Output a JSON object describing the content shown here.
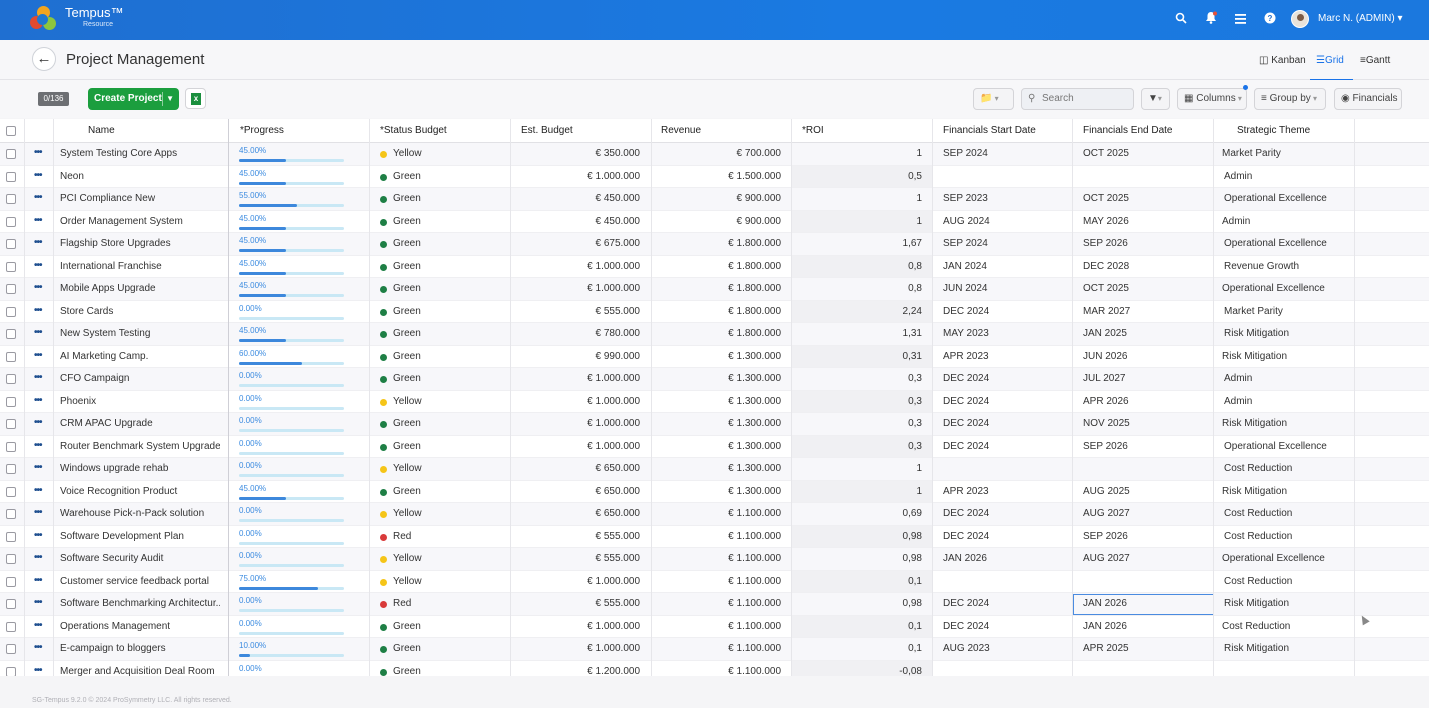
{
  "app": {
    "brand": "Tempus™",
    "brand_sub": "Resource",
    "user": "Marc N. (ADMIN) ▾",
    "icons": [
      "search-icon",
      "notification-bell-icon",
      "menu-icon",
      "help-icon"
    ]
  },
  "page": {
    "title": "Project Management",
    "views": [
      "Kanban",
      "Grid",
      "Gantt"
    ],
    "active_view": "Grid"
  },
  "toolbar": {
    "count": "0/136",
    "create_label": "Create Project",
    "search_placeholder": "Search",
    "columns_label": "Columns",
    "group_label": "Group by",
    "financials_label": "Financials"
  },
  "grid": {
    "columns": [
      "Name",
      "*Progress",
      "*Status Budget",
      "Est. Budget",
      "Revenue",
      "*ROI",
      "Financials Start Date",
      "Financials End Date",
      "Strategic Theme"
    ],
    "status_colors": {
      "Yellow": "#f5c518",
      "Green": "#1e7f45",
      "Red": "#d93a3a"
    },
    "rows": [
      {
        "name": "System Testing Core Apps",
        "progress": "45.00%",
        "progress_value": 45,
        "status": "Yellow",
        "budget": "€ 350.000",
        "revenue": "€ 700.000",
        "roi": "1",
        "start": "SEP 2024",
        "end": "OCT 2025",
        "theme": "Market Parity"
      },
      {
        "name": "Neon",
        "progress": "45.00%",
        "progress_value": 45,
        "status": "Green",
        "budget": "€ 1.000.000",
        "revenue": "€ 1.500.000",
        "roi": "0,5",
        "start": "",
        "end": "",
        "theme": "Admin"
      },
      {
        "name": "PCI Compliance New",
        "progress": "55.00%",
        "progress_value": 55,
        "status": "Green",
        "budget": "€ 450.000",
        "revenue": "€ 900.000",
        "roi": "1",
        "start": "SEP 2023",
        "end": "OCT 2025",
        "theme": "Operational Excellence"
      },
      {
        "name": "Order Management System",
        "progress": "45.00%",
        "progress_value": 45,
        "status": "Green",
        "budget": "€ 450.000",
        "revenue": "€ 900.000",
        "roi": "1",
        "start": "AUG 2024",
        "end": "MAY 2026",
        "theme": "Admin"
      },
      {
        "name": "Flagship Store Upgrades",
        "progress": "45.00%",
        "progress_value": 45,
        "status": "Green",
        "budget": "€ 675.000",
        "revenue": "€ 1.800.000",
        "roi": "1,67",
        "start": "SEP 2024",
        "end": "SEP 2026",
        "theme": "Operational Excellence"
      },
      {
        "name": "International Franchise",
        "progress": "45.00%",
        "progress_value": 45,
        "status": "Green",
        "budget": "€ 1.000.000",
        "revenue": "€ 1.800.000",
        "roi": "0,8",
        "start": "JAN 2024",
        "end": "DEC 2028",
        "theme": "Revenue Growth"
      },
      {
        "name": "Mobile Apps Upgrade",
        "progress": "45.00%",
        "progress_value": 45,
        "status": "Green",
        "budget": "€ 1.000.000",
        "revenue": "€ 1.800.000",
        "roi": "0,8",
        "start": "JUN 2024",
        "end": "OCT 2025",
        "theme": "Operational Excellence"
      },
      {
        "name": "Store Cards",
        "progress": "0.00%",
        "progress_value": 0,
        "status": "Green",
        "budget": "€ 555.000",
        "revenue": "€ 1.800.000",
        "roi": "2,24",
        "start": "DEC 2024",
        "end": "MAR 2027",
        "theme": "Market Parity"
      },
      {
        "name": "New System Testing",
        "progress": "45.00%",
        "progress_value": 45,
        "status": "Green",
        "budget": "€ 780.000",
        "revenue": "€ 1.800.000",
        "roi": "1,31",
        "start": "MAY 2023",
        "end": "JAN 2025",
        "theme": "Risk Mitigation"
      },
      {
        "name": "AI Marketing Camp.",
        "progress": "60.00%",
        "progress_value": 60,
        "status": "Green",
        "budget": "€ 990.000",
        "revenue": "€ 1.300.000",
        "roi": "0,31",
        "start": "APR 2023",
        "end": "JUN 2026",
        "theme": "Risk Mitigation"
      },
      {
        "name": "CFO Campaign",
        "progress": "0.00%",
        "progress_value": 0,
        "status": "Green",
        "budget": "€ 1.000.000",
        "revenue": "€ 1.300.000",
        "roi": "0,3",
        "start": "DEC 2024",
        "end": "JUL 2027",
        "theme": "Admin"
      },
      {
        "name": "Phoenix",
        "progress": "0.00%",
        "progress_value": 0,
        "status": "Yellow",
        "budget": "€ 1.000.000",
        "revenue": "€ 1.300.000",
        "roi": "0,3",
        "start": "DEC 2024",
        "end": "APR 2026",
        "theme": "Admin"
      },
      {
        "name": "CRM APAC Upgrade",
        "progress": "0.00%",
        "progress_value": 0,
        "status": "Green",
        "budget": "€ 1.000.000",
        "revenue": "€ 1.300.000",
        "roi": "0,3",
        "start": "DEC 2024",
        "end": "NOV 2025",
        "theme": "Risk Mitigation"
      },
      {
        "name": "Router Benchmark System Upgrade",
        "progress": "0.00%",
        "progress_value": 0,
        "status": "Green",
        "budget": "€ 1.000.000",
        "revenue": "€ 1.300.000",
        "roi": "0,3",
        "start": "DEC 2024",
        "end": "SEP 2026",
        "theme": "Operational Excellence"
      },
      {
        "name": "Windows upgrade rehab",
        "progress": "0.00%",
        "progress_value": 0,
        "status": "Yellow",
        "budget": "€ 650.000",
        "revenue": "€ 1.300.000",
        "roi": "1",
        "start": "",
        "end": "",
        "theme": "Cost Reduction"
      },
      {
        "name": "Voice Recognition Product",
        "progress": "45.00%",
        "progress_value": 45,
        "status": "Green",
        "budget": "€ 650.000",
        "revenue": "€ 1.300.000",
        "roi": "1",
        "start": "APR 2023",
        "end": "AUG 2025",
        "theme": "Risk Mitigation"
      },
      {
        "name": "Warehouse Pick-n-Pack solution",
        "progress": "0.00%",
        "progress_value": 0,
        "status": "Yellow",
        "budget": "€ 650.000",
        "revenue": "€ 1.100.000",
        "roi": "0,69",
        "start": "DEC 2024",
        "end": "AUG 2027",
        "theme": "Cost Reduction"
      },
      {
        "name": "Software Development Plan",
        "progress": "0.00%",
        "progress_value": 0,
        "status": "Red",
        "budget": "€ 555.000",
        "revenue": "€ 1.100.000",
        "roi": "0,98",
        "start": "DEC 2024",
        "end": "SEP 2026",
        "theme": "Cost Reduction"
      },
      {
        "name": "Software Security Audit",
        "progress": "0.00%",
        "progress_value": 0,
        "status": "Yellow",
        "budget": "€ 555.000",
        "revenue": "€ 1.100.000",
        "roi": "0,98",
        "start": "JAN 2026",
        "end": "AUG 2027",
        "theme": "Operational Excellence"
      },
      {
        "name": "Customer service feedback portal",
        "progress": "75.00%",
        "progress_value": 75,
        "status": "Yellow",
        "budget": "€ 1.000.000",
        "revenue": "€ 1.100.000",
        "roi": "0,1",
        "start": "",
        "end": "",
        "theme": "Cost Reduction"
      },
      {
        "name": "Software Benchmarking Architectur...",
        "progress": "0.00%",
        "progress_value": 0,
        "status": "Red",
        "budget": "€ 555.000",
        "revenue": "€ 1.100.000",
        "roi": "0,98",
        "start": "DEC 2024",
        "end": "JAN 2026",
        "theme": "Risk Mitigation"
      },
      {
        "name": "Operations Management",
        "progress": "0.00%",
        "progress_value": 0,
        "status": "Green",
        "budget": "€ 1.000.000",
        "revenue": "€ 1.100.000",
        "roi": "0,1",
        "start": "DEC 2024",
        "end": "JAN 2026",
        "theme": "Cost Reduction"
      },
      {
        "name": "E-campaign to bloggers",
        "progress": "10.00%",
        "progress_value": 10,
        "status": "Green",
        "budget": "€ 1.000.000",
        "revenue": "€ 1.100.000",
        "roi": "0,1",
        "start": "AUG 2023",
        "end": "APR 2025",
        "theme": "Risk Mitigation"
      },
      {
        "name": "Merger and Acquisition Deal Room",
        "progress": "0.00%",
        "progress_value": 0,
        "status": "Green",
        "budget": "€ 1.200.000",
        "revenue": "€ 1.100.000",
        "roi": "-0,08",
        "start": "",
        "end": "",
        "theme": ""
      }
    ]
  },
  "footer": "SG-Tempus 9.2.0 © 2024 ProSymmetry LLC. All rights reserved."
}
